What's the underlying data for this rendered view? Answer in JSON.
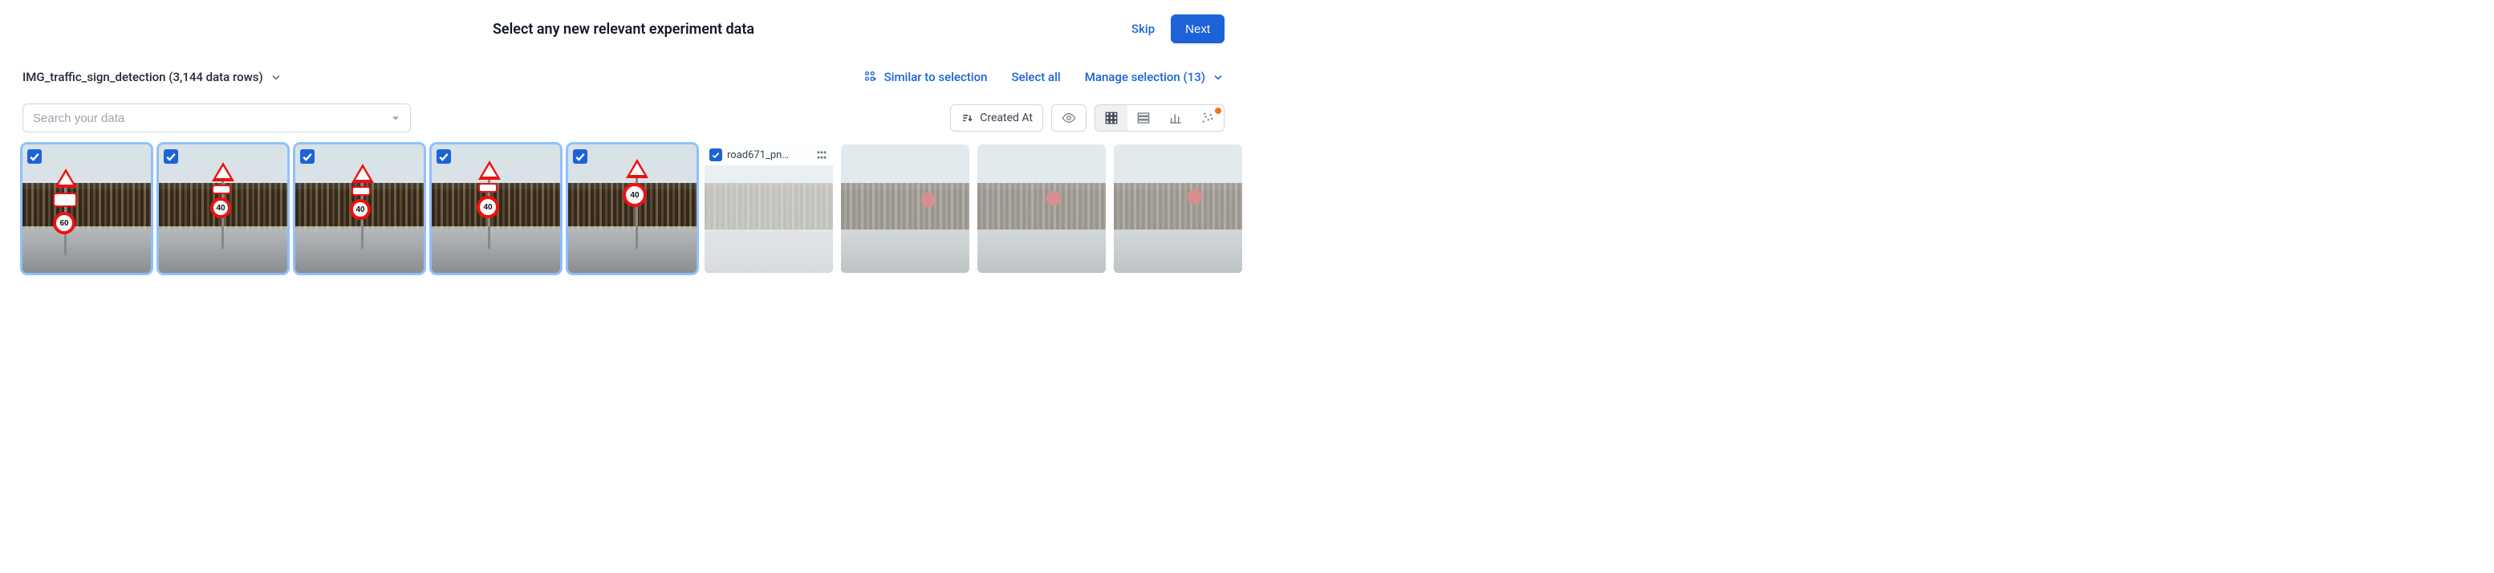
{
  "header": {
    "title": "Select any new relevant experiment data",
    "skip_label": "Skip",
    "next_label": "Next"
  },
  "dataset": {
    "label": "IMG_traffic_sign_detection (3,144 data rows)"
  },
  "actions": {
    "similar_label": "Similar to selection",
    "select_all_label": "Select all",
    "manage_label": "Manage selection (13)"
  },
  "search": {
    "placeholder": "Search your data"
  },
  "sort": {
    "label": "Created At"
  },
  "thumbs": {
    "hover_name": "road671_pn…"
  }
}
